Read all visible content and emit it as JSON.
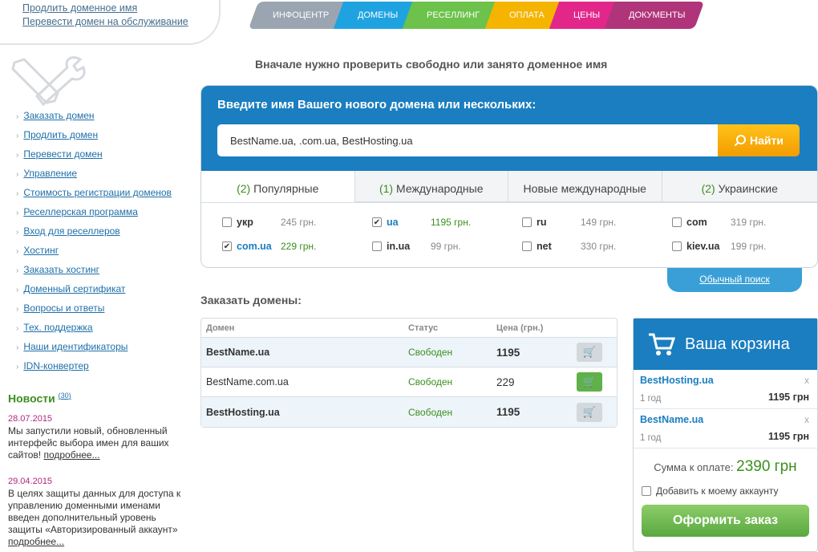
{
  "top_links": [
    "Продлить доменное имя",
    "Перевести домен на обслуживание"
  ],
  "nav": [
    {
      "label": "ИНФОЦЕНТР",
      "color": "#9aa5b1"
    },
    {
      "label": "ДОМЕНЫ",
      "color": "#1ea3e0"
    },
    {
      "label": "РЕСЕЛЛИНГ",
      "color": "#6cc24a"
    },
    {
      "label": "ОПЛАТА",
      "color": "#f5b400"
    },
    {
      "label": "ЦЕНЫ",
      "color": "#e2268a"
    },
    {
      "label": "ДОКУМЕНТЫ",
      "color": "#b0347a"
    }
  ],
  "sidebar": {
    "items": [
      "Заказать домен",
      "Продлить домен",
      "Перевести домен",
      "Управление",
      "Стоимость регистрации доменов",
      "Реселлерская программа",
      "Вход для реселлеров",
      "Хостинг",
      "Заказать хостинг",
      "Доменный сертификат",
      "Вопросы и ответы",
      "Тех. поддержка",
      "Наши идентификаторы",
      "IDN-конвертер"
    ]
  },
  "news": {
    "title": "Новости",
    "count": "30",
    "items": [
      {
        "date": "28.07.2015",
        "text": "Мы запустили новый, обновленный интерфейс выбора имен для ваших сайтов!",
        "more": "подробнее..."
      },
      {
        "date": "29.04.2015",
        "text": "В целях защиты данных для доступа к управлению доменными именами введен дополнительный уровень защиты «Авторизированный аккаунт»",
        "more": "подробнее..."
      }
    ]
  },
  "main": {
    "heading": "Вначале нужно проверить свободно или занято доменное имя",
    "search_label": "Введите имя Вашего нового домена или нескольких:",
    "search_value": "BestName.ua, .com.ua, BestHosting.ua",
    "search_button": "Найти",
    "tabs": [
      {
        "count": "(2)",
        "label": "Популярные"
      },
      {
        "count": "(1)",
        "label": "Международные"
      },
      {
        "count": "",
        "label": "Новые международные"
      },
      {
        "count": "(2)",
        "label": "Украинские"
      }
    ],
    "zones": [
      {
        "name": "укр",
        "price": "245 грн.",
        "checked": false
      },
      {
        "name": "ua",
        "price": "1195 грн.",
        "checked": true
      },
      {
        "name": "ru",
        "price": "149 грн.",
        "checked": false
      },
      {
        "name": "com",
        "price": "319 грн.",
        "checked": false
      },
      {
        "name": "com.ua",
        "price": "229 грн.",
        "checked": true
      },
      {
        "name": "in.ua",
        "price": "99 грн.",
        "checked": false
      },
      {
        "name": "net",
        "price": "330 грн.",
        "checked": false
      },
      {
        "name": "kiev.ua",
        "price": "199 грн.",
        "checked": false
      }
    ],
    "simple_search": "Обычный поиск",
    "order_title": "Заказать домены:",
    "table_headers": [
      "Домен",
      "Статус",
      "Цена (грн.)"
    ],
    "rows": [
      {
        "domain": "BestName.ua",
        "status": "Свободен",
        "price": "1195",
        "in_cart": true
      },
      {
        "domain": "BestName.com.ua",
        "status": "Свободен",
        "price": "229",
        "in_cart": false
      },
      {
        "domain": "BestHosting.ua",
        "status": "Свободен",
        "price": "1195",
        "in_cart": true
      }
    ]
  },
  "basket": {
    "title": "Ваша корзина",
    "items": [
      {
        "domain": "BestHosting.ua",
        "period": "1 год",
        "price": "1195 грн",
        "remove": "x"
      },
      {
        "domain": "BestName.ua",
        "period": "1 год",
        "price": "1195 грн",
        "remove": "x"
      }
    ],
    "sum_label": "Сумма к оплате:",
    "sum_value": "2390 грн",
    "add_to_account": "Добавить к моему аккаунту",
    "order_button": "Оформить заказ"
  }
}
